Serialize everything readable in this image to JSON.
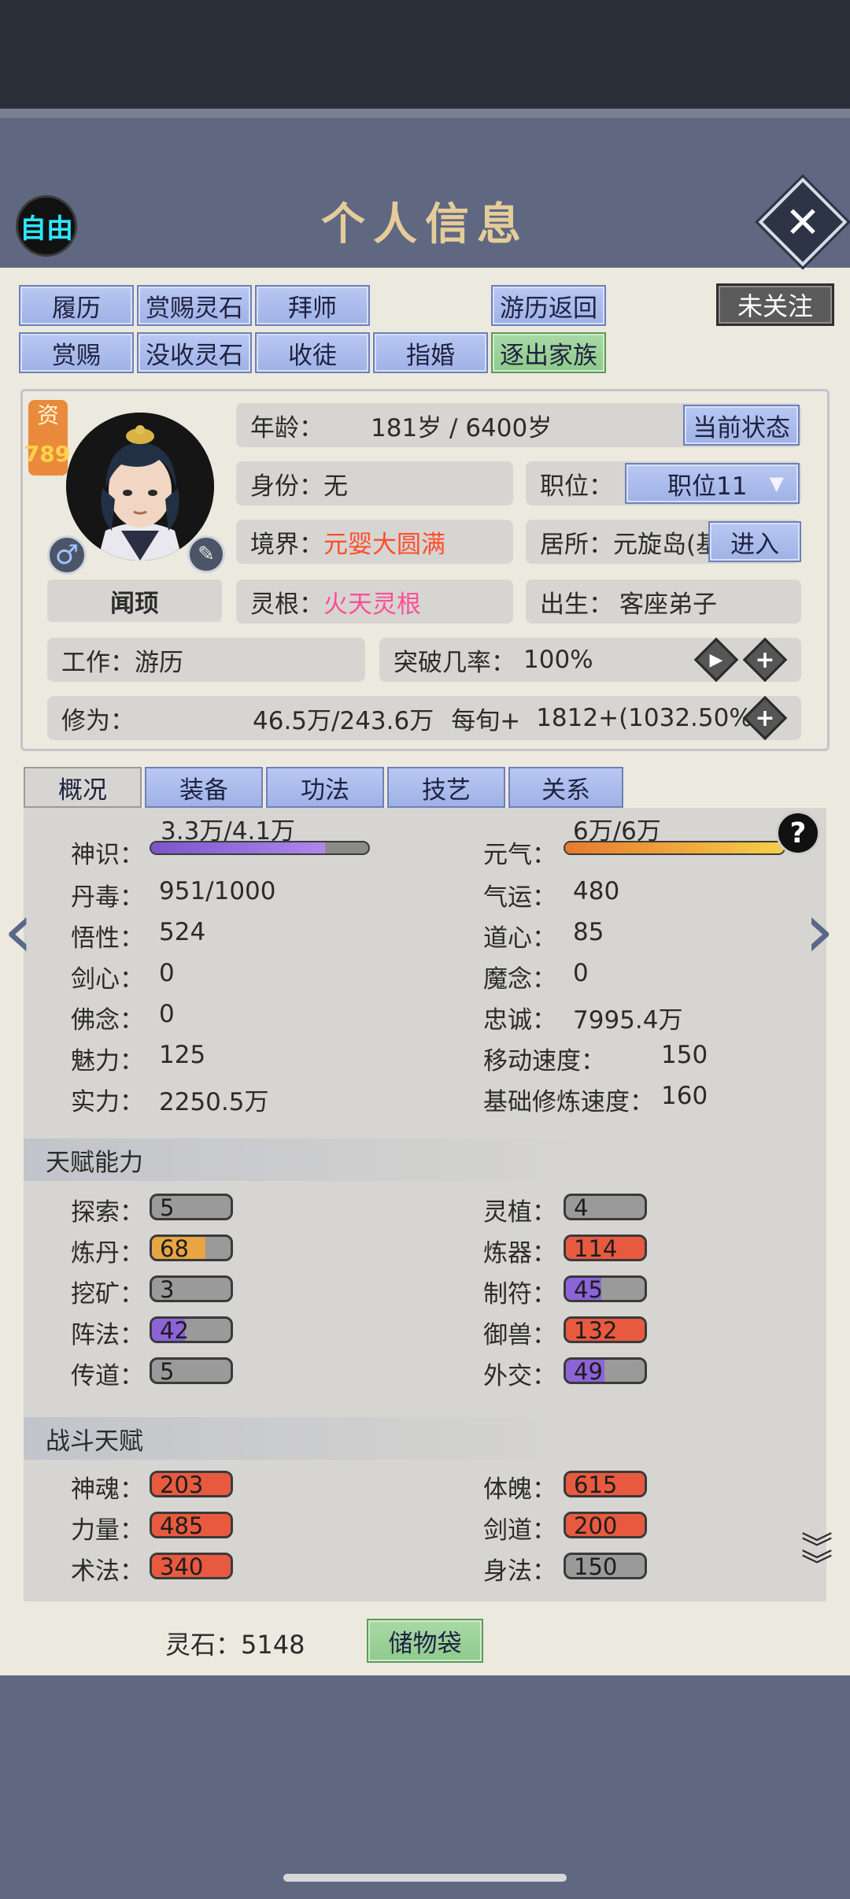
{
  "header": {
    "mode_badge": "自由",
    "title": "个人信息",
    "close_icon": "close-icon"
  },
  "actions": {
    "row1": [
      "履历",
      "赏赐灵石",
      "拜师",
      "游历返回"
    ],
    "row2": [
      "赏赐",
      "没收灵石",
      "收徒",
      "指婚",
      "逐出家族"
    ],
    "follow": "未关注"
  },
  "profile": {
    "zi_label": "资",
    "zi_value": "789",
    "name_button": "闻顼",
    "age_label": "年龄：",
    "age_value": "181岁 / 6400岁",
    "current_state": "当前状态",
    "identity_label": "身份：",
    "identity_value": "无",
    "position_label": "职位：",
    "position_value": "职位11",
    "realm_label": "境界：",
    "realm_value": "元婴大圆满",
    "residence_label": "居所：",
    "residence_value": "元旋岛(基",
    "enter": "进入",
    "root_label": "灵根：",
    "root_value": "火天灵根",
    "birth_label": "出生：",
    "birth_value": "客座弟子",
    "job_label": "工作：",
    "job_value": "游历",
    "breakthrough_label": "突破几率：",
    "breakthrough_value": "100%",
    "cultivation_label": "修为：",
    "cultivation_value": "46.5万/243.6万",
    "per_turn_label": "每旬+",
    "per_turn_value": "1812+(1032.50%)"
  },
  "tabs": [
    "概况",
    "装备",
    "功法",
    "技艺",
    "关系"
  ],
  "stats": {
    "shenshi_label": "神识：",
    "shenshi_value": "3.3万/4.1万",
    "shenshi_fraction": 0.8,
    "yuanqi_label": "元气：",
    "yuanqi_value": "6万/6万",
    "yuanqi_fraction": 1.0,
    "left": [
      {
        "label": "丹毒：",
        "value": "951/1000"
      },
      {
        "label": "悟性：",
        "value": "524"
      },
      {
        "label": "剑心：",
        "value": "0"
      },
      {
        "label": "佛念：",
        "value": "0"
      },
      {
        "label": "魅力：",
        "value": "125"
      },
      {
        "label": "实力：",
        "value": "2250.5万"
      }
    ],
    "right": [
      {
        "label": "气运：",
        "value": "480"
      },
      {
        "label": "道心：",
        "value": "85"
      },
      {
        "label": "魔念：",
        "value": "0"
      },
      {
        "label": "忠诚：",
        "value": "7995.4万"
      },
      {
        "label": "移动速度：",
        "value": "150"
      },
      {
        "label": "基础修炼速度：",
        "value": "160"
      }
    ]
  },
  "talents": {
    "title": "天赋能力",
    "left": [
      {
        "label": "探索：",
        "value": "5",
        "color": "#9a9a9a",
        "fill": 0
      },
      {
        "label": "炼丹：",
        "value": "68",
        "color": "#e8a544",
        "fill": 0.68
      },
      {
        "label": "挖矿：",
        "value": "3",
        "color": "#9a9a9a",
        "fill": 0
      },
      {
        "label": "阵法：",
        "value": "42",
        "color": "#8d63d8",
        "fill": 0.42
      },
      {
        "label": "传道：",
        "value": "5",
        "color": "#9a9a9a",
        "fill": 0
      }
    ],
    "right": [
      {
        "label": "灵植：",
        "value": "4",
        "color": "#9a9a9a",
        "fill": 0
      },
      {
        "label": "炼器：",
        "value": "114",
        "color": "#e85a40",
        "fill": 1
      },
      {
        "label": "制符：",
        "value": "45",
        "color": "#8d63d8",
        "fill": 0.45
      },
      {
        "label": "御兽：",
        "value": "132",
        "color": "#e85a40",
        "fill": 1
      },
      {
        "label": "外交：",
        "value": "49",
        "color": "#8d63d8",
        "fill": 0.49
      }
    ]
  },
  "combat": {
    "title": "战斗天赋",
    "left": [
      {
        "label": "神魂：",
        "value": "203",
        "color": "#e85a40",
        "fill": 1
      },
      {
        "label": "力量：",
        "value": "485",
        "color": "#e85a40",
        "fill": 1
      },
      {
        "label": "术法：",
        "value": "340",
        "color": "#e85a40",
        "fill": 1
      }
    ],
    "right": [
      {
        "label": "体魄：",
        "value": "615",
        "color": "#e85a40",
        "fill": 1
      },
      {
        "label": "剑道：",
        "value": "200",
        "color": "#e85a40",
        "fill": 1
      },
      {
        "label": "身法：",
        "value": "150",
        "color": "#9a9a9a",
        "fill": 0
      }
    ]
  },
  "footer": {
    "lingshi_label": "灵石：",
    "lingshi_value": "5148",
    "bag": "储物袋"
  }
}
